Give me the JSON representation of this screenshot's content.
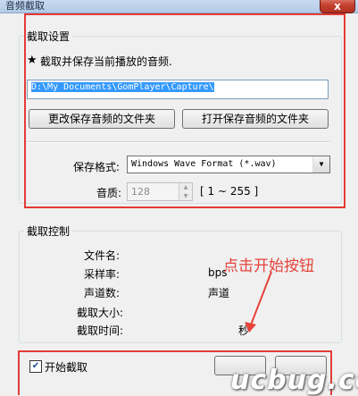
{
  "window": {
    "title": "音频截取",
    "close_glyph": "x"
  },
  "capture_settings": {
    "legend": "截取设置",
    "info_star": "★",
    "info_text": "截取并保存当前播放的音频.",
    "path_value": "D:\\My Documents\\GomPlayer\\Capture\\",
    "change_folder_button": "更改保存音频的文件夹",
    "open_folder_button": "打开保存音频的文件夹",
    "format_label": "保存格式:",
    "format_value": "Windows Wave Format (*.wav)",
    "quality_label": "音质:",
    "quality_value": "128",
    "quality_range": "[ 1 ~ 255 ]"
  },
  "capture_control": {
    "legend": "截取控制",
    "rows": [
      {
        "label": "文件名:",
        "value": ""
      },
      {
        "label": "采样率:",
        "value": "bps"
      },
      {
        "label": "声道数:",
        "value": "声道"
      },
      {
        "label": "截取大小:",
        "value": ""
      },
      {
        "label": "截取时间:",
        "value": "秒"
      }
    ]
  },
  "footer": {
    "start_capture_label": "开始截取",
    "start_checked_mark": "✔"
  },
  "annotation": {
    "text": "点击开始按钮",
    "color": "#e6423a"
  },
  "watermark": {
    "text": "ucbug.cc"
  }
}
